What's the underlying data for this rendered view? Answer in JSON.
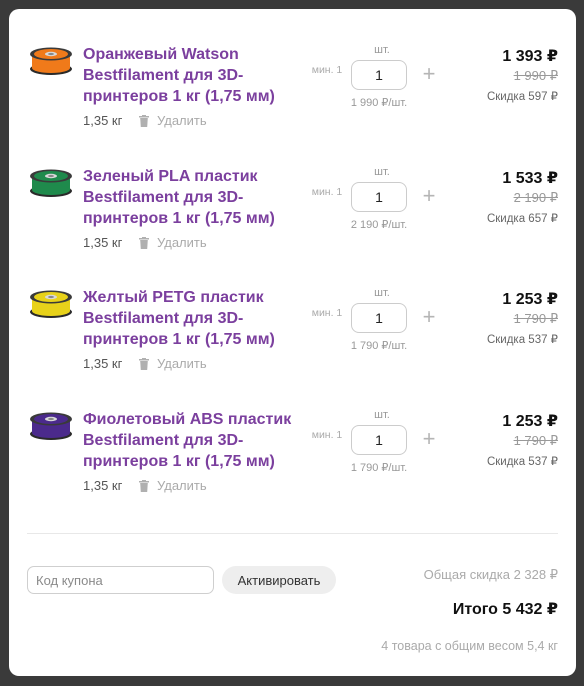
{
  "items": [
    {
      "title": "Оранжевый Watson Bestfilament для 3D-принтеров 1 кг (1,75 мм)",
      "weight": "1,35 кг",
      "delete_label": "Удалить",
      "qty_unit": "шт.",
      "qty_min": "мин. 1",
      "qty": "1",
      "unit_price": "1 990 ₽/шт.",
      "price": "1 393 ₽",
      "old_price": "1 990 ₽",
      "discount": "Скидка 597 ₽",
      "spool_color": "#f07a1a"
    },
    {
      "title": "Зеленый PLA пластик Bestfilament для 3D-принтеров 1 кг (1,75 мм)",
      "weight": "1,35 кг",
      "delete_label": "Удалить",
      "qty_unit": "шт.",
      "qty_min": "мин. 1",
      "qty": "1",
      "unit_price": "2 190 ₽/шт.",
      "price": "1 533 ₽",
      "old_price": "2 190 ₽",
      "discount": "Скидка 657 ₽",
      "spool_color": "#1f8a4c"
    },
    {
      "title": "Желтый PETG пластик Bestfilament для 3D-принтеров 1 кг (1,75 мм)",
      "weight": "1,35 кг",
      "delete_label": "Удалить",
      "qty_unit": "шт.",
      "qty_min": "мин. 1",
      "qty": "1",
      "unit_price": "1 790 ₽/шт.",
      "price": "1 253 ₽",
      "old_price": "1 790 ₽",
      "discount": "Скидка 537 ₽",
      "spool_color": "#e8d21a"
    },
    {
      "title": "Фиолетовый ABS пластик Bestfilament для 3D-принтеров 1 кг (1,75 мм)",
      "weight": "1,35 кг",
      "delete_label": "Удалить",
      "qty_unit": "шт.",
      "qty_min": "мин. 1",
      "qty": "1",
      "unit_price": "1 790 ₽/шт.",
      "price": "1 253 ₽",
      "old_price": "1 790 ₽",
      "discount": "Скидка 537 ₽",
      "spool_color": "#4b2a8c"
    }
  ],
  "coupon": {
    "placeholder": "Код купона",
    "activate_label": "Активировать"
  },
  "summary": {
    "total_discount": "Общая скидка 2 328 ₽",
    "total": "Итого 5 432 ₽",
    "note": "4 товара с общим весом 5,4 кг"
  },
  "colors": {
    "title": "#7b3f9e"
  },
  "icons": {
    "delete": "trash-icon",
    "increase": "plus-icon",
    "product": "filament-spool-icon"
  }
}
